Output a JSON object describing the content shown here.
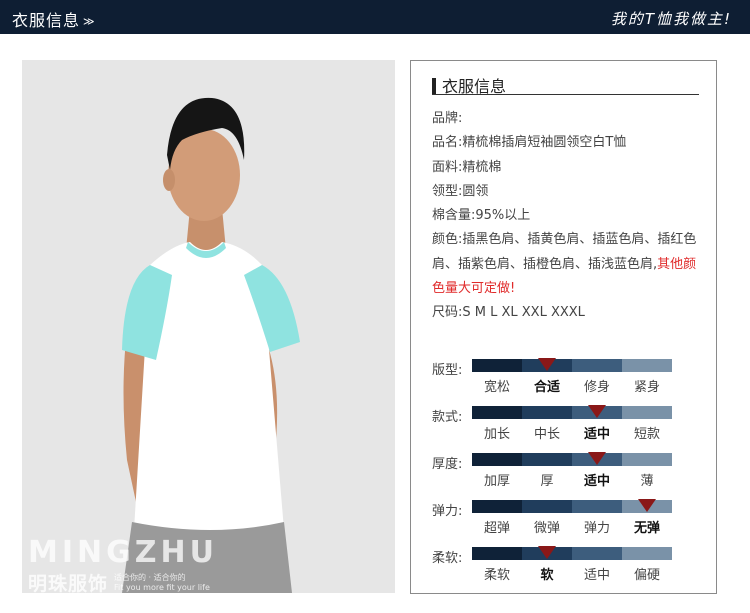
{
  "header": {
    "title": "衣服信息",
    "chevron_icon": "chevron-double-down-icon",
    "slogan": "我的T恤我做主!"
  },
  "photo": {
    "brand_en": "MINGZHU",
    "brand_cn": "明珠服饰",
    "tagline_cn": "适合你的 · 适合你的",
    "tagline_en": "Fit you more fit your life",
    "colors": {
      "shirt_body": "#ffffff",
      "sleeves": "#8fe3e0",
      "background": "#e8e8e8"
    }
  },
  "panel": {
    "title": "衣服信息",
    "specs": {
      "brand": "品牌:",
      "name": "品名:精梳棉插肩短袖圆领空白T恤",
      "fabric": "面料:精梳棉",
      "collar": "领型:圆领",
      "cotton": "棉含量:95%以上",
      "colors": "颜色:插黑色肩、插黄色肩、插蓝色肩、插红色肩、插紫色肩、插橙色肩、插浅蓝色肩,",
      "colors_note": "其他颜色量大可定做!",
      "sizes": "尺码:S M L XL XXL XXXL"
    },
    "fit_chart": [
      {
        "label": "版型:",
        "options": [
          "宽松",
          "合适",
          "修身",
          "紧身"
        ],
        "selected": 1
      },
      {
        "label": "款式:",
        "options": [
          "加长",
          "中长",
          "适中",
          "短款"
        ],
        "selected": 2
      },
      {
        "label": "厚度:",
        "options": [
          "加厚",
          "厚",
          "适中",
          "薄"
        ],
        "selected": 2
      },
      {
        "label": "弹力:",
        "options": [
          "超弹",
          "微弹",
          "弹力",
          "无弹"
        ],
        "selected": 3
      },
      {
        "label": "柔软:",
        "options": [
          "柔软",
          "软",
          "适中",
          "偏硬"
        ],
        "selected": 1
      }
    ],
    "colors": {
      "marker": "#8a1818",
      "bar": [
        "#0f2238",
        "#203d5c",
        "#3d5d7d",
        "#7a92a8"
      ],
      "note_red": "#e02b2b"
    }
  }
}
